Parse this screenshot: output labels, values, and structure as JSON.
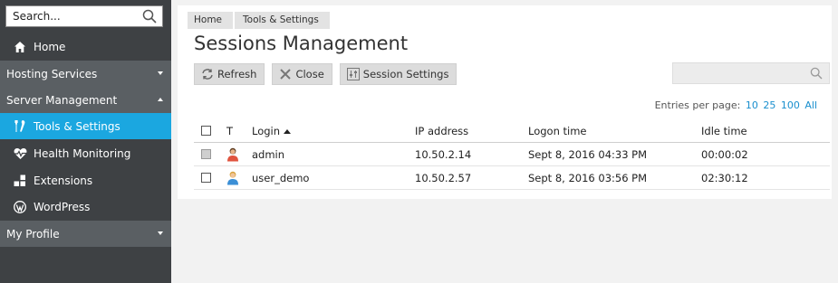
{
  "sidebar": {
    "search": {
      "placeholder": "Search..."
    },
    "items": [
      {
        "label": "Home",
        "icon": "home-icon"
      },
      {
        "label": "Hosting Services",
        "type": "group",
        "expanded": false
      },
      {
        "label": "Server Management",
        "type": "group",
        "expanded": true
      },
      {
        "label": "Tools & Settings",
        "icon": "tools-icon",
        "active": true
      },
      {
        "label": "Health Monitoring",
        "icon": "heart-pulse-icon"
      },
      {
        "label": "Extensions",
        "icon": "extensions-icon"
      },
      {
        "label": "WordPress",
        "icon": "wordpress-icon"
      },
      {
        "label": "My Profile",
        "type": "group",
        "expanded": false
      }
    ]
  },
  "breadcrumb": [
    "Home",
    "Tools & Settings"
  ],
  "page_title": "Sessions Management",
  "toolbar": {
    "refresh_label": "Refresh",
    "close_label": "Close",
    "session_settings_label": "Session Settings"
  },
  "list_search": {
    "placeholder": ""
  },
  "pagination": {
    "label": "Entries per page:",
    "options": [
      "10",
      "25",
      "100",
      "All"
    ]
  },
  "table": {
    "columns": {
      "type": "T",
      "login": "Login",
      "ip": "IP address",
      "logon": "Logon time",
      "idle": "Idle time"
    },
    "sort": {
      "column": "login",
      "direction": "ascending"
    },
    "rows": [
      {
        "checkbox_disabled": true,
        "user_type_icon": "admin-user-icon",
        "login": "admin",
        "ip": "10.50.2.14",
        "logon": "Sept 8, 2016 04:33 PM",
        "idle": "00:00:02"
      },
      {
        "checkbox_disabled": false,
        "user_type_icon": "regular-user-icon",
        "login": "user_demo",
        "ip": "10.50.2.57",
        "logon": "Sept 8, 2016 03:56 PM",
        "idle": "02:30:12"
      }
    ]
  },
  "colors": {
    "sidebar_bg": "#3e4144",
    "group_bg": "#5a5f63",
    "active_bg": "#1ba7e0",
    "link": "#1a8fce"
  }
}
